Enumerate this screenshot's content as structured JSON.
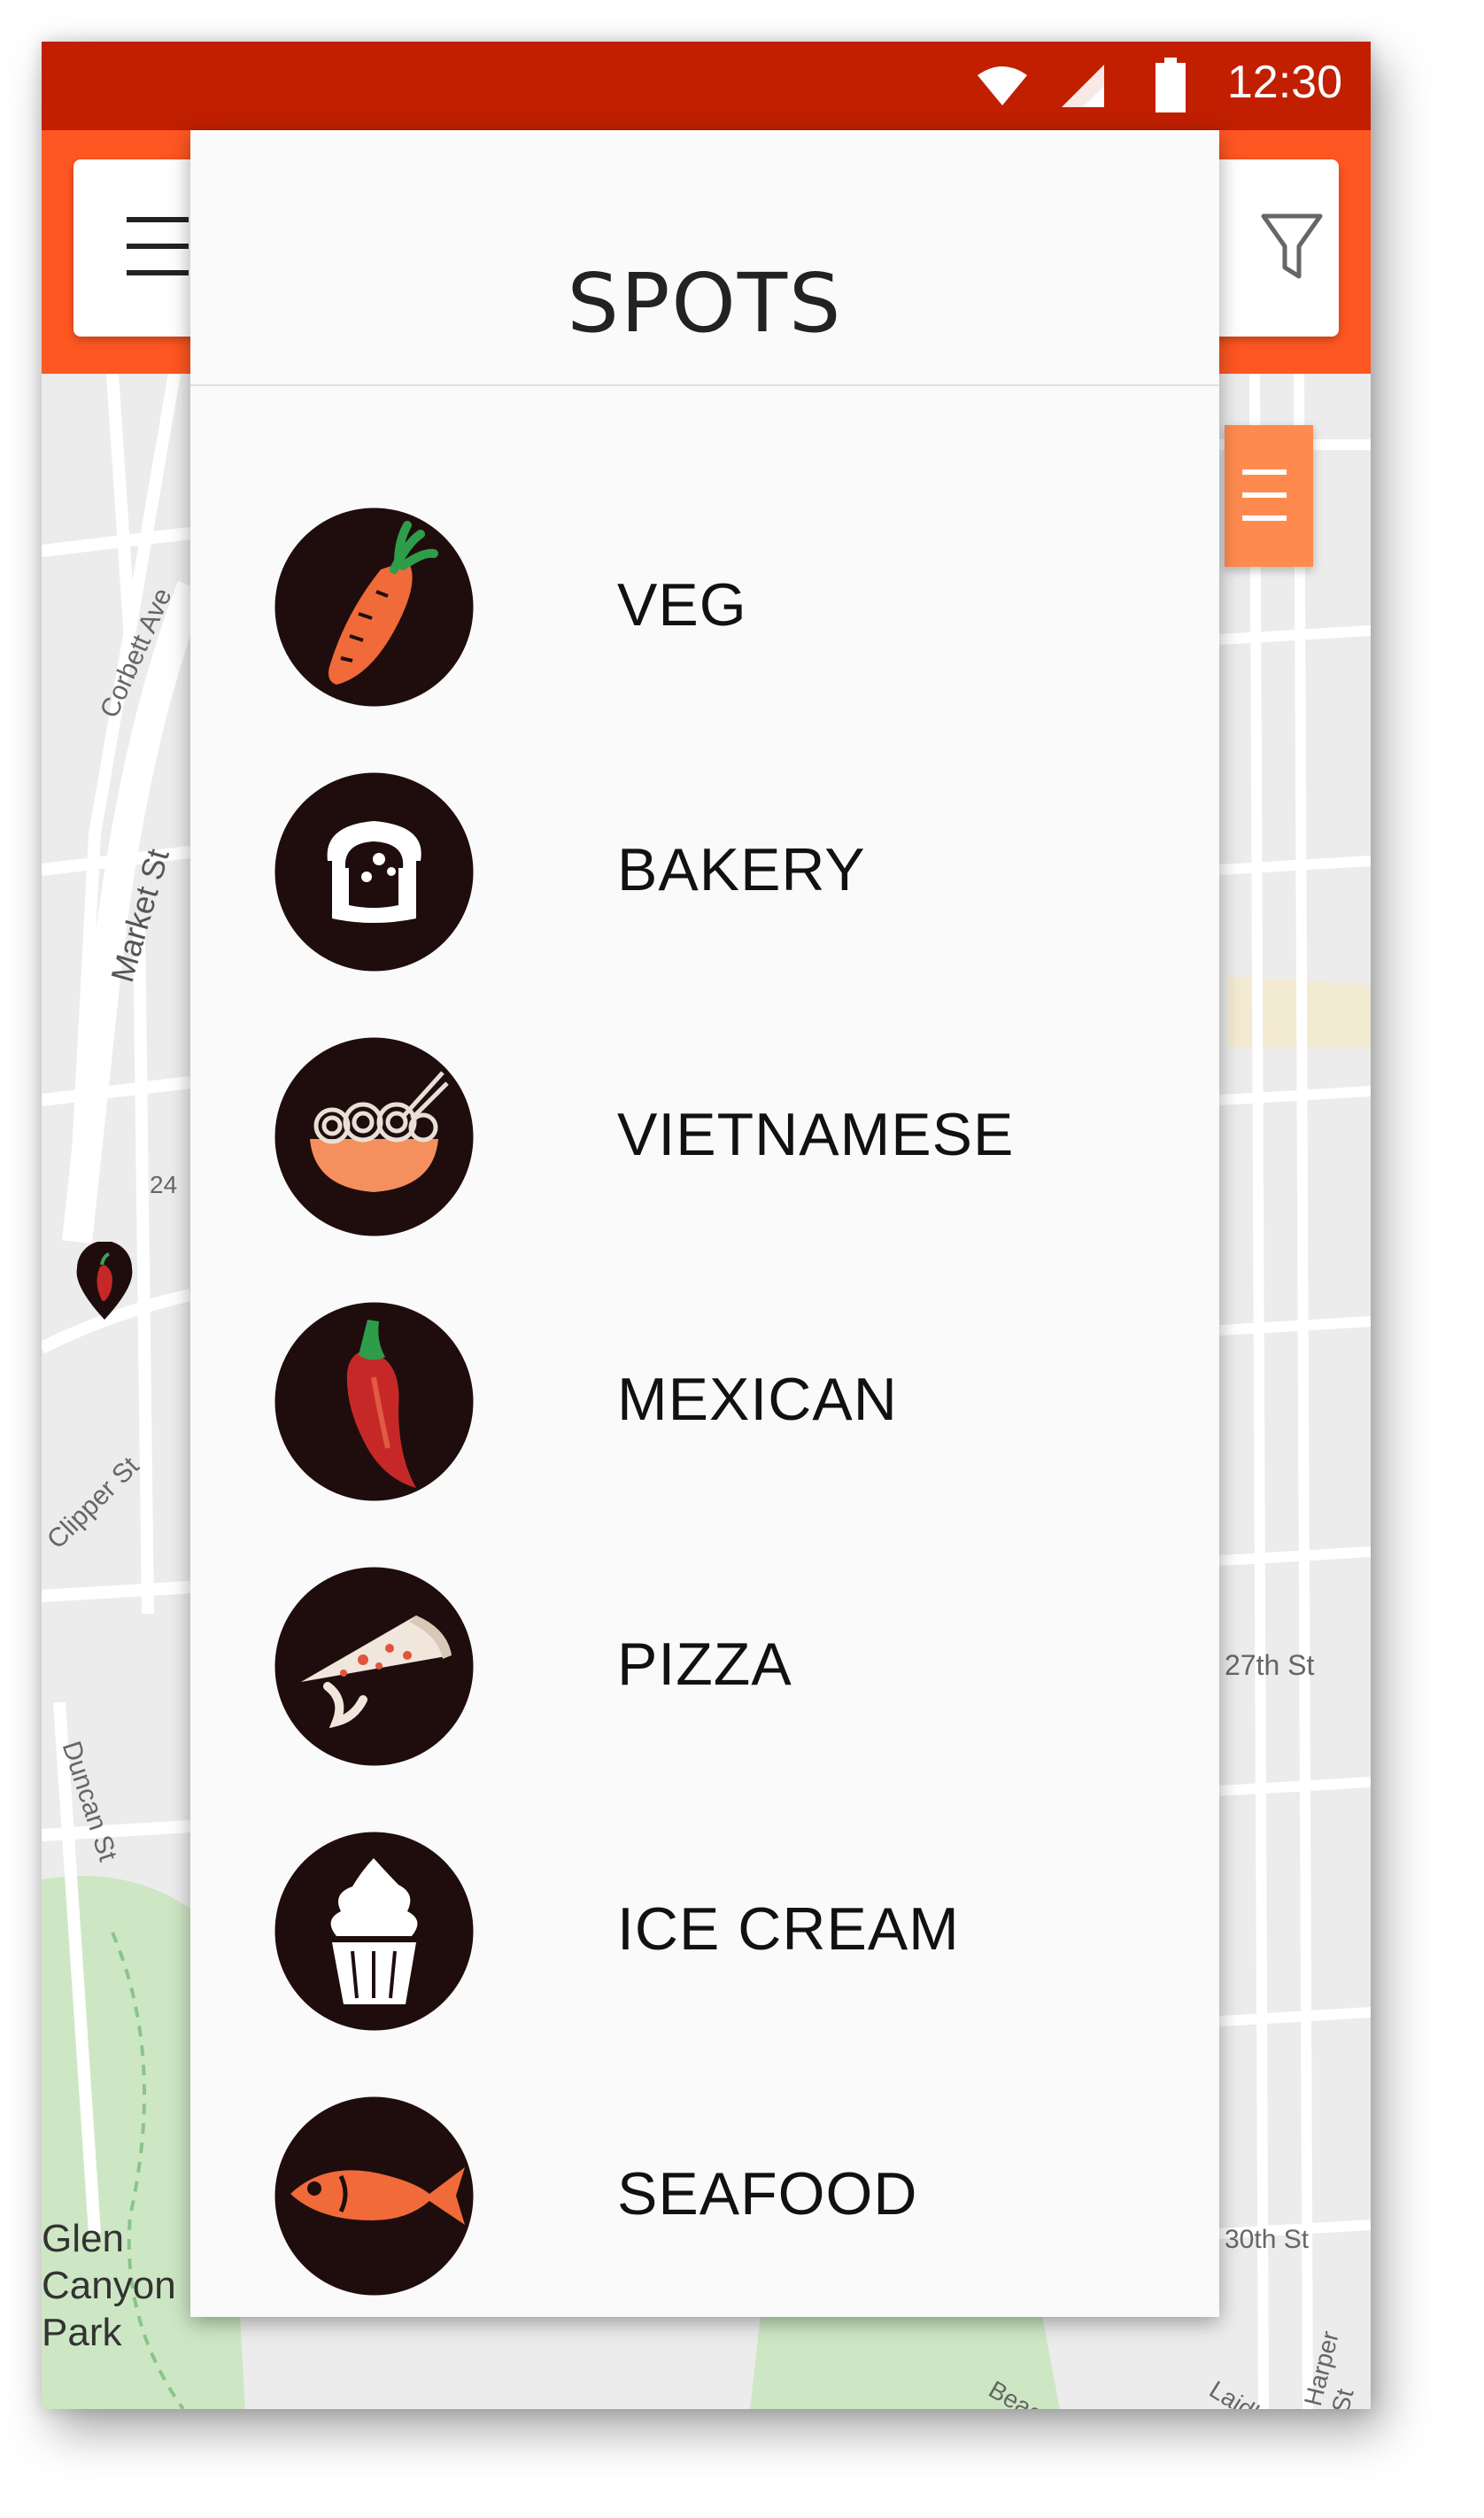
{
  "status_bar": {
    "time": "12:30",
    "icons": [
      "wifi-icon",
      "cell-signal-icon",
      "battery-icon"
    ],
    "color": "#c11f00"
  },
  "app_bar": {
    "color": "#ff5722",
    "icons": [
      "menu-icon",
      "filter-icon"
    ]
  },
  "map": {
    "street_labels": [
      "Corbett Ave",
      "Market St",
      "Clipper St",
      "Duncan St",
      "27th St",
      "Glen Canyon Park",
      "Beacon St",
      "Harper St",
      "Laidley St",
      "24",
      "30th St"
    ],
    "marker": "chili-marker-icon"
  },
  "spots_panel": {
    "title": "SPOTS",
    "items": [
      {
        "label": "VEG",
        "icon": "carrot-icon"
      },
      {
        "label": "BAKERY",
        "icon": "bread-icon"
      },
      {
        "label": "VIETNAMESE",
        "icon": "noodle-bowl-icon"
      },
      {
        "label": "MEXICAN",
        "icon": "chili-pepper-icon"
      },
      {
        "label": "PIZZA",
        "icon": "pizza-slice-icon"
      },
      {
        "label": "ICE CREAM",
        "icon": "ice-cream-icon"
      },
      {
        "label": "SEAFOOD",
        "icon": "fish-icon"
      }
    ]
  },
  "colors": {
    "accent": "#ff5722",
    "icon_circle": "#1f0d0d",
    "icon_fill": "#f06a3a",
    "panel_bg": "#fafafa"
  }
}
